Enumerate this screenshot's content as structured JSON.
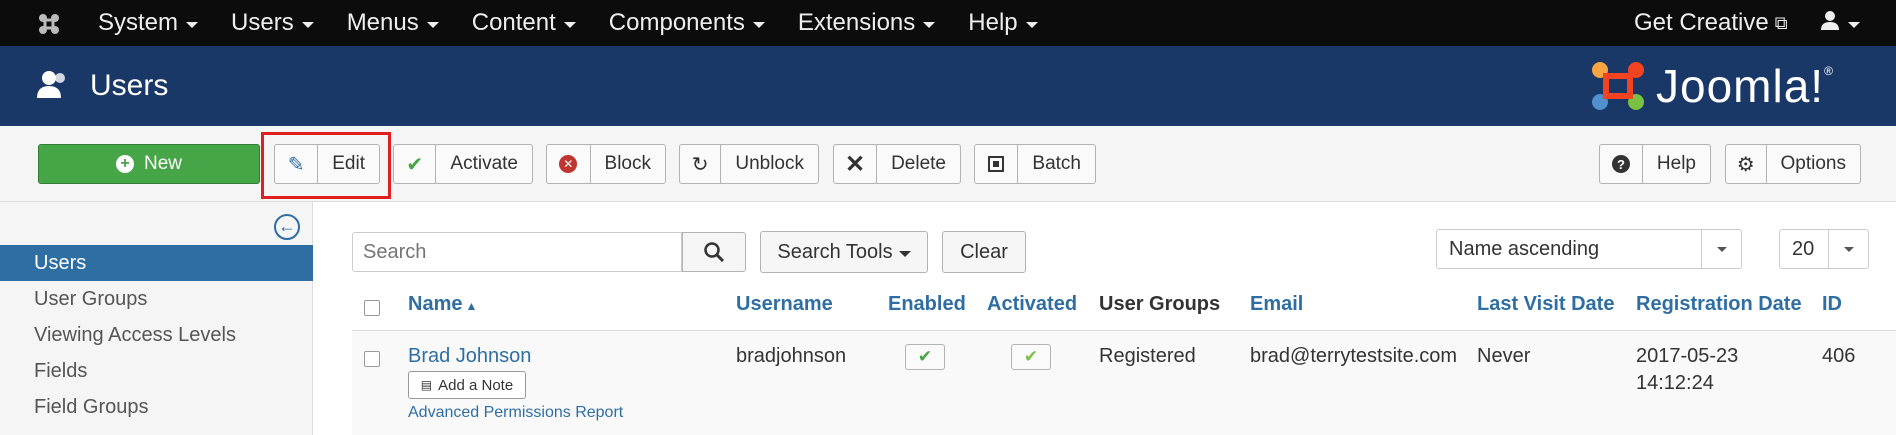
{
  "topnav": {
    "menu": [
      "System",
      "Users",
      "Menus",
      "Content",
      "Components",
      "Extensions",
      "Help"
    ],
    "get_creative": "Get Creative"
  },
  "header": {
    "title": "Users",
    "brand": "Joomla!",
    "brand_mark": "®"
  },
  "toolbar": {
    "new": "New",
    "edit": "Edit",
    "activate": "Activate",
    "block": "Block",
    "unblock": "Unblock",
    "delete": "Delete",
    "batch": "Batch",
    "help": "Help",
    "options": "Options"
  },
  "sidebar": {
    "items": [
      "Users",
      "User Groups",
      "Viewing Access Levels",
      "Fields",
      "Field Groups"
    ],
    "active": "Users"
  },
  "filters": {
    "search_placeholder": "Search",
    "search_tools": "Search Tools",
    "clear": "Clear",
    "ordering": "Name ascending",
    "limit": "20"
  },
  "table": {
    "headers": {
      "name": "Name",
      "username": "Username",
      "enabled": "Enabled",
      "activated": "Activated",
      "user_groups": "User Groups",
      "email": "Email",
      "last_visit": "Last Visit Date",
      "registration": "Registration Date",
      "id": "ID"
    },
    "rows": [
      {
        "name": "Brad Johnson",
        "add_note": "Add a Note",
        "permissions_link": "Advanced Permissions Report",
        "username": "bradjohnson",
        "user_groups": "Registered",
        "email": "brad@terrytestsite.com",
        "last_visit": "Never",
        "registration_date": "2017-05-23",
        "registration_time": "14:12:24",
        "id": "406"
      }
    ]
  },
  "colors": {
    "header_bg": "#1a3867",
    "accent": "#2f6ea3",
    "new_button": "#46a546",
    "highlight": "#e02020"
  }
}
